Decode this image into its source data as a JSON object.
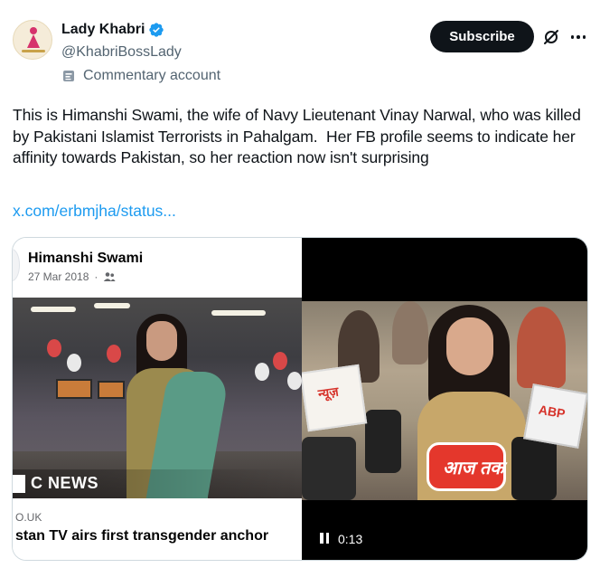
{
  "author": {
    "display_name": "Lady Khabri",
    "handle": "@KhabriBossLady",
    "label": "Commentary account",
    "avatar_icon": "lady-khabri-logo",
    "verified_color": "#1d9bf0"
  },
  "header_actions": {
    "subscribe_label": "Subscribe",
    "grok_icon": "slashed-circle-icon",
    "more_icon": "more-icon"
  },
  "tweet": {
    "text": "This is Himanshi Swami, the wife of Navy Lieutenant Vinay Narwal, who was killed by Pakistani Islamist Terrorists in Pahalgam.  Her FB profile seems to indicate her affinity towards Pakistan, so her reaction now isn't surprising",
    "link": "x.com/erbmjha/status..."
  },
  "media": {
    "left": {
      "fb_name": "Himanshi Swami",
      "fb_date": "27 Mar 2018",
      "fb_audience_icon": "friends-icon",
      "photo_overlay": "C NEWS",
      "link_domain": "O.UK",
      "link_title": "stan TV airs first transgender anchor"
    },
    "right": {
      "mic_logo_text": "आज तक",
      "mic_box_left_text": "न्यूज़",
      "mic_box_right_text": "ABP",
      "video_time": "0:13",
      "pause_icon": "pause-icon"
    }
  },
  "colors": {
    "accent": "#1d9bf0",
    "text_primary": "#0f1419",
    "text_secondary": "#536471",
    "button_bg": "#0f1419"
  }
}
